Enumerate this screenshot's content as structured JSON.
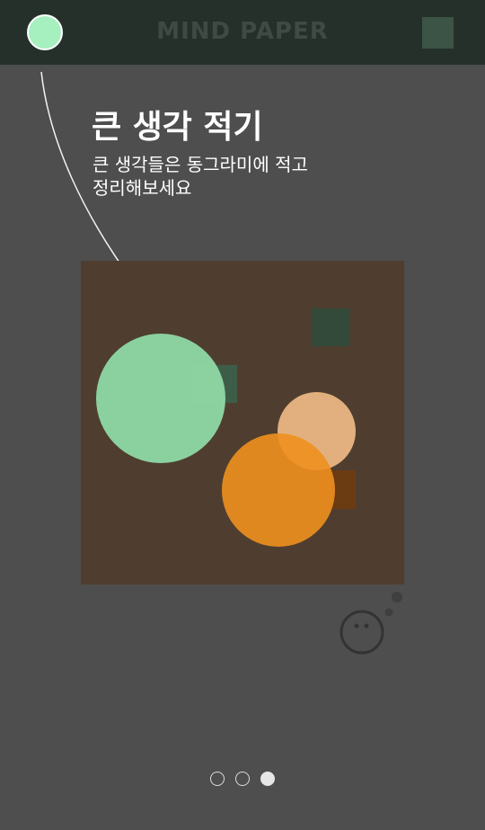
{
  "header": {
    "title": "MIND PAPER",
    "left_button_icon": "green-circle-icon",
    "right_button_icon": "green-square-icon",
    "colors": {
      "bar": "#25302a",
      "left_button": "#a6f0bf",
      "right_button": "#3c5446",
      "title": "#3f4a44"
    }
  },
  "coach": {
    "title": "큰 생각 적기",
    "description": "큰 생각들은 동그라미에 적고 정리해보세요"
  },
  "canvas": {
    "background": "#4f3e2f",
    "shapes": [
      {
        "kind": "square",
        "color": "#334a3a"
      },
      {
        "kind": "square",
        "color": "#3d5d48"
      },
      {
        "kind": "circle",
        "color": "#8dd4a2"
      },
      {
        "kind": "circle",
        "color": "#e1b07e"
      },
      {
        "kind": "square",
        "color": "#6b3b12"
      },
      {
        "kind": "circle",
        "color": "#f0901f"
      }
    ]
  },
  "mascot": {
    "icon": "thinking-face-icon"
  },
  "pager": {
    "total": 3,
    "active_index": 2
  }
}
